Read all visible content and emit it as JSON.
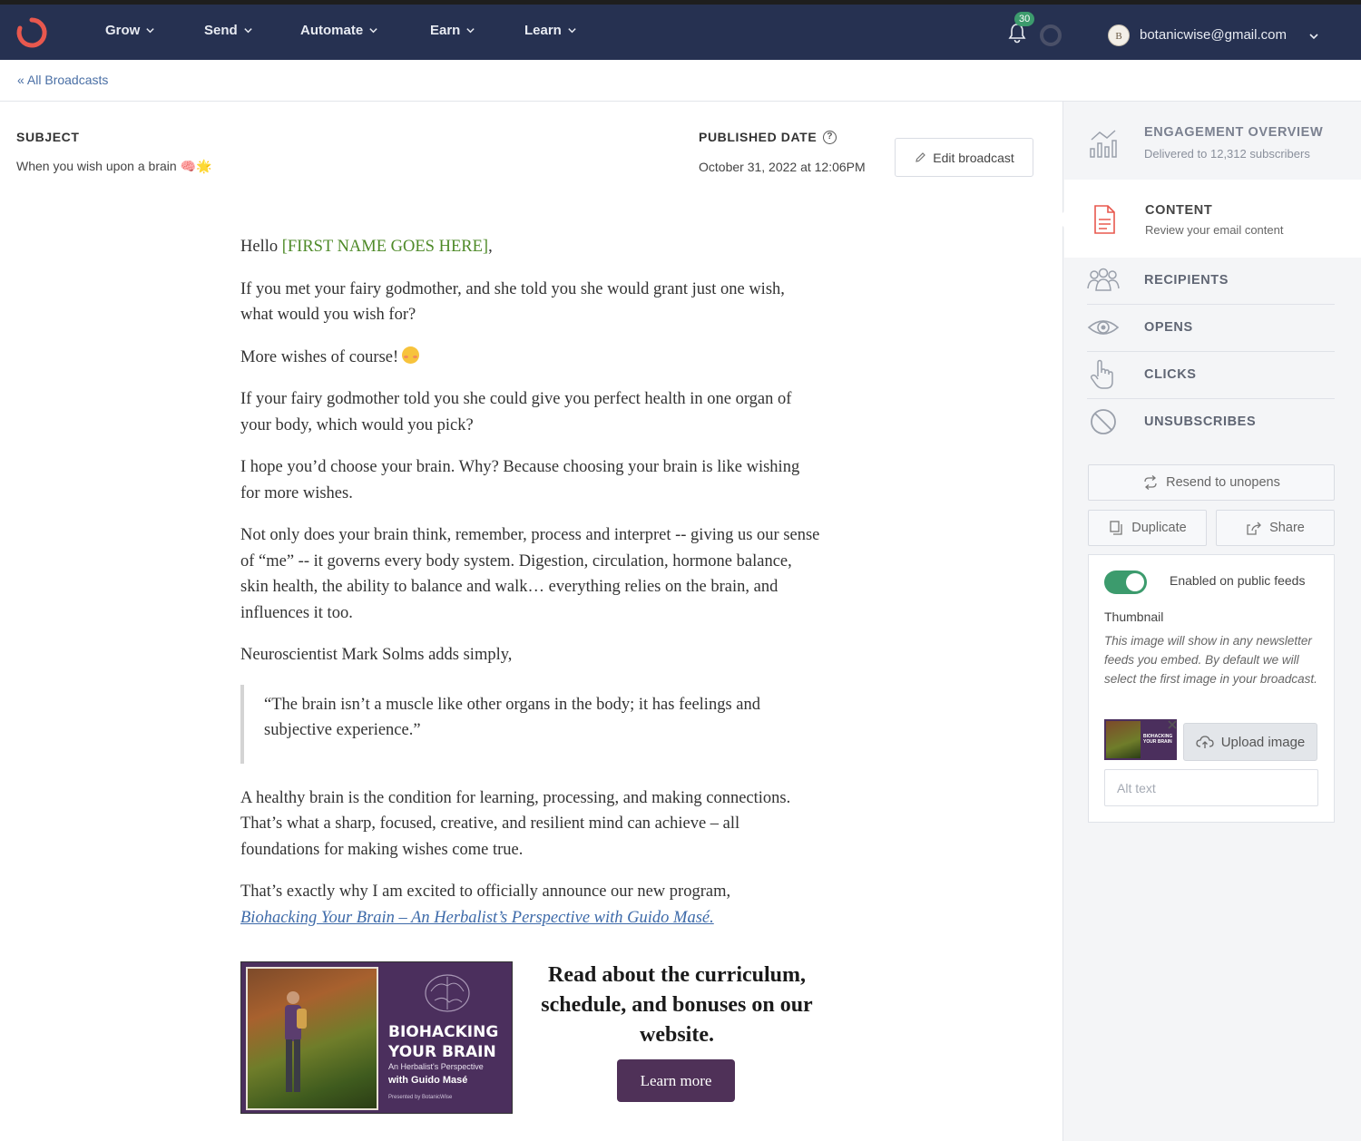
{
  "nav": {
    "items": [
      "Grow",
      "Send",
      "Automate",
      "Earn",
      "Learn"
    ],
    "notification_count": "30",
    "avatar_initial": "B",
    "account_email": "botanicwise@gmail.com"
  },
  "breadcrumb": "« All Broadcasts",
  "broadcast": {
    "subject_label": "SUBJECT",
    "subject": "When you wish upon a brain 🧠🌟",
    "published_label": "PUBLISHED DATE",
    "published_date": "October 31, 2022 at 12:06PM",
    "edit_label": "Edit broadcast"
  },
  "email": {
    "greeting_prefix": "Hello ",
    "merge_tag": "[FIRST NAME GOES HERE]",
    "greeting_suffix": ",",
    "p1": "If you met your fairy godmother, and she told you she would grant just one wish, what would you wish for?",
    "p2": "More wishes of course!",
    "p3": "If your fairy godmother told you she could give you perfect health in one organ of your body, which would you pick?",
    "p4": "I hope you’d choose your brain. Why? Because choosing your brain is like wishing for more wishes.",
    "p5": "Not only does your brain think, remember, process and interpret -- giving us our sense of “me” -- it governs every body system. Digestion, circulation, hormone balance, skin health, the ability to balance and walk… everything relies on the brain, and influences it too.",
    "p6": "Neuroscientist Mark Solms adds simply,",
    "quote": "“The brain isn’t a muscle like other organs in the body; it has feelings and subjective experience.”",
    "p7": "A healthy brain is the condition for learning, processing, and making connections. That’s what a sharp, focused, creative, and resilient mind can achieve – all foundations for making wishes come true.",
    "p8": "That’s exactly why I am excited to officially announce our new program,",
    "link": "Biohacking Your Brain – An Herbalist’s Perspective with Guido Masé.",
    "promo_title_1": "BIOHACKING",
    "promo_title_2": "YOUR BRAIN",
    "promo_sub": "An Herbalist's Perspective",
    "promo_with": "with Guido Masé",
    "promo_brand": "Presented by BotanicWise",
    "promo_heading": "Read about the curriculum, schedule, and bonuses on our website.",
    "cta": "Learn more"
  },
  "sidebar": {
    "engagement_title": "ENGAGEMENT OVERVIEW",
    "engagement_sub": "Delivered to 12,312 subscribers",
    "content_title": "CONTENT",
    "content_sub": "Review your email content",
    "recipients": "RECIPIENTS",
    "opens": "OPENS",
    "clicks": "CLICKS",
    "unsubscribes": "UNSUBSCRIBES",
    "resend": "Resend to unopens",
    "duplicate": "Duplicate",
    "share": "Share",
    "public_feeds": "Enabled on public feeds",
    "public_feeds_enabled": true,
    "thumbnail_label": "Thumbnail",
    "thumbnail_desc": "This image will show in any newsletter feeds you embed. By default we will select the first image in your broadcast.",
    "upload": "Upload image",
    "alt_placeholder": "Alt text"
  },
  "colors": {
    "nav_bg": "#263151",
    "accent_green": "#3c9b6d",
    "cta_purple": "#4f3158",
    "logo_red": "#e8584e"
  },
  "icons": [
    "logo-icon",
    "chevron-down-icon",
    "bell-icon",
    "status-ring-icon",
    "pencil-icon",
    "help-icon",
    "chart-icon",
    "document-icon",
    "people-icon",
    "eye-icon",
    "pointer-hand-icon",
    "ban-icon",
    "resend-icon",
    "duplicate-icon",
    "share-icon",
    "close-icon",
    "cloud-upload-icon"
  ]
}
